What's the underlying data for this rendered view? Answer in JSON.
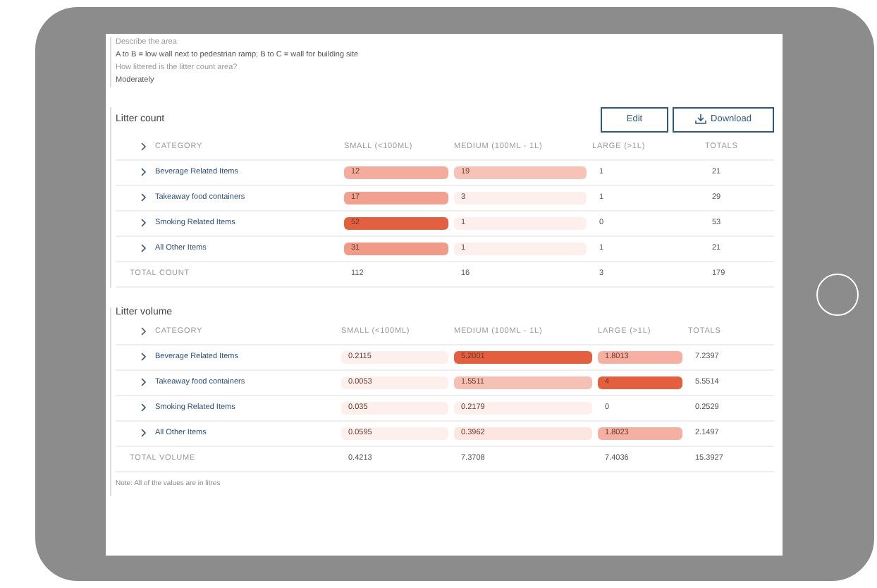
{
  "intro": {
    "question_1": "Describe the area",
    "answer_1": "A to B = low wall next to pedestrian ramp; B to C = wall for building site",
    "question_2": "How littered is the litter count area?",
    "answer_2": "Moderately"
  },
  "litter_count": {
    "title": "Litter count",
    "buttons": [
      {
        "label": "Edit",
        "kind": "plain"
      },
      {
        "label": "Download",
        "kind": "download"
      }
    ],
    "columns": [
      "CATEGORY",
      "SMALL (<100ML)",
      "MEDIUM (100ML - 1L)",
      "LARGE (>1L)",
      "TOTALS"
    ],
    "rows": [
      {
        "kind": "item",
        "cells": [
          {
            "text": "Beverage Related Items"
          },
          {
            "text": "12",
            "color": "#f4ac9c"
          },
          {
            "text": "19",
            "color": "#f8c3b7"
          },
          {
            "text": "1"
          },
          {
            "text": "21"
          }
        ]
      },
      {
        "kind": "item",
        "cells": [
          {
            "text": "Takeaway food containers"
          },
          {
            "text": "17",
            "color": "#f2a08f"
          },
          {
            "text": "3",
            "color": "#fdf0ec"
          },
          {
            "text": "1"
          },
          {
            "text": "29"
          }
        ]
      },
      {
        "kind": "item",
        "cells": [
          {
            "text": "Smoking Related Items"
          },
          {
            "text": "52",
            "color": "#e2603f"
          },
          {
            "text": "1",
            "color": "#fdf0ec"
          },
          {
            "text": "0"
          },
          {
            "text": "53"
          }
        ]
      },
      {
        "kind": "item",
        "cells": [
          {
            "text": "All Other Items"
          },
          {
            "text": "31",
            "color": "#f19a88"
          },
          {
            "text": "1",
            "color": "#fdf0ec"
          },
          {
            "text": "1"
          },
          {
            "text": "21"
          }
        ]
      },
      {
        "kind": "total",
        "cells": [
          {
            "text": "TOTAL COUNT"
          },
          {
            "text": "112"
          },
          {
            "text": "16"
          },
          {
            "text": "3"
          },
          {
            "text": "179"
          }
        ]
      }
    ]
  },
  "litter_volume": {
    "title": "Litter volume",
    "columns": [
      "CATEGORY",
      "SMALL (<100ML)",
      "MEDIUM (100ML - 1L)",
      "LARGE (>1L)",
      "TOTALS"
    ],
    "rows": [
      {
        "kind": "item",
        "cells": [
          {
            "text": "Beverage Related Items"
          },
          {
            "text": "0.2115",
            "color": "#fdf0ec"
          },
          {
            "text": "5.2001",
            "color": "#e45f3d"
          },
          {
            "text": "1.8013",
            "color": "#f5b0a2"
          },
          {
            "text": "7.2397"
          }
        ]
      },
      {
        "kind": "item",
        "cells": [
          {
            "text": "Takeaway food containers"
          },
          {
            "text": "0.0053",
            "color": "#fdf0ec"
          },
          {
            "text": "1.5511",
            "color": "#f7c0b4"
          },
          {
            "text": "4",
            "color": "#e45f3d"
          },
          {
            "text": "5.5514"
          }
        ]
      },
      {
        "kind": "item",
        "cells": [
          {
            "text": "Smoking Related Items"
          },
          {
            "text": "0.035",
            "color": "#fdf0ec"
          },
          {
            "text": "0.2179",
            "color": "#fdf0ec"
          },
          {
            "text": "0"
          },
          {
            "text": "0.2529"
          }
        ]
      },
      {
        "kind": "item",
        "cells": [
          {
            "text": "All Other Items"
          },
          {
            "text": "0.0595",
            "color": "#fdf0ec"
          },
          {
            "text": "0.3962",
            "color": "#fde6e0"
          },
          {
            "text": "1.8023",
            "color": "#f5b0a2"
          },
          {
            "text": "2.1497"
          }
        ]
      },
      {
        "kind": "total",
        "cells": [
          {
            "text": "TOTAL VOLUME"
          },
          {
            "text": "0.4213"
          },
          {
            "text": "7.3708"
          },
          {
            "text": "7.4036"
          },
          {
            "text": "15.3927"
          }
        ]
      }
    ],
    "note": "Note: All of the values are in litres"
  }
}
